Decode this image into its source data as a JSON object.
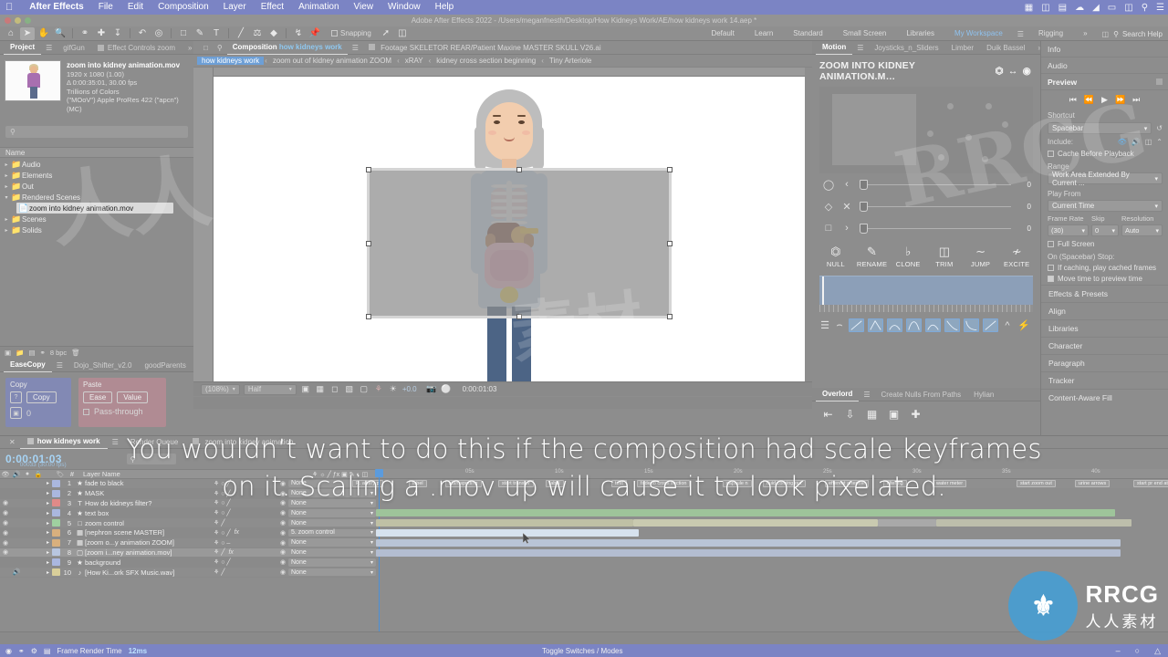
{
  "macmenu": {
    "apple": "apple-logo",
    "items": [
      "After Effects",
      "File",
      "Edit",
      "Composition",
      "Layer",
      "Effect",
      "Animation",
      "View",
      "Window",
      "Help"
    ],
    "right_icons": [
      "▦",
      "⌘",
      "◑",
      "☁",
      "⌗",
      "⊕",
      "▣",
      "ὐD",
      "☰"
    ]
  },
  "title": "Adobe After Effects 2022 - /Users/meganfnesth/Desktop/How Kidneys Work/AE/how kidneys work 14.aep *",
  "toolbar": {
    "tools": [
      "home",
      "selection",
      "hand",
      "zoom",
      "orbit",
      "pan-behind",
      "anchor",
      "rotation",
      "shape",
      "mask",
      "pen",
      "type",
      "brush",
      "clone",
      "eraser",
      "roto",
      "puppet"
    ],
    "snapping_label": "Snapping"
  },
  "workspace": {
    "tabs": [
      "Default",
      "Learn",
      "Standard",
      "Small Screen",
      "Libraries",
      "My Workspace",
      "Rigging"
    ],
    "active": "My Workspace",
    "overflow": "»",
    "search_placeholder": "Search Help"
  },
  "project": {
    "tabs": [
      {
        "label": "Project",
        "active": true
      },
      {
        "label": "gifGun",
        "active": false
      },
      {
        "label": "Effect Controls zoom",
        "active": false
      }
    ],
    "selected_asset": {
      "name": "zoom into kidney animation.mov",
      "dimensions": "1920 x 1080 (1.00)",
      "duration": "Δ 0:00:35:01, 30.00 fps",
      "colors": "Trillions of Colors",
      "codec": "(\"MOoV\") Apple ProRes 422 (\"apcn\") (MC)"
    },
    "search_placeholder": "",
    "column_header": "Name",
    "tree": [
      {
        "label": "Audio",
        "type": "folder",
        "expanded": false,
        "indent": 0
      },
      {
        "label": "Elements",
        "type": "folder",
        "expanded": false,
        "indent": 0
      },
      {
        "label": "Out",
        "type": "folder",
        "expanded": false,
        "indent": 0
      },
      {
        "label": "Rendered Scenes",
        "type": "folder",
        "expanded": true,
        "indent": 0
      },
      {
        "label": "zoom into kidney animation.mov",
        "type": "footage",
        "expanded": false,
        "indent": 1,
        "selected": true
      },
      {
        "label": "Scenes",
        "type": "folder",
        "expanded": false,
        "indent": 0
      },
      {
        "label": "Solids",
        "type": "folder",
        "expanded": false,
        "indent": 0
      }
    ],
    "footer_bpc": "8 bpc"
  },
  "easecopy": {
    "tabs": [
      {
        "label": "EaseCopy",
        "active": true
      },
      {
        "label": "Dojo_Shifter_v2.0",
        "active": false
      },
      {
        "label": "goodParents",
        "active": false
      }
    ],
    "copy_title": "Copy",
    "copy_button": "Copy",
    "copy_value": "0",
    "paste_title": "Paste",
    "paste_ease": "Ease",
    "paste_value": "Value",
    "passthrough": "Pass-through"
  },
  "composition": {
    "tabs": [
      {
        "label_prefix": "Composition",
        "label_name": "how kidneys work",
        "active": true
      },
      {
        "label_prefix": "Footage",
        "label_name": "SKELETOR REAR/Patient Maxine MASTER SKULL V26.ai",
        "active": false
      }
    ],
    "breadcrumb": [
      "how kidneys work",
      "zoom out of kidney animation ZOOM",
      "xRAY",
      "kidney cross section beginning",
      "Tiny Arteriole"
    ],
    "zoom_level": "(108%)",
    "resolution": "Half",
    "exposure": "+0.0",
    "timecode": "0:00:01:03"
  },
  "motion": {
    "tabs": [
      {
        "label": "Motion",
        "active": true
      },
      {
        "label": "Joysticks_n_Sliders",
        "active": false
      },
      {
        "label": "Limber",
        "active": false
      },
      {
        "label": "Duik Bassel",
        "active": false
      }
    ],
    "title": "ZOOM INTO KIDNEY ANIMATION.M…",
    "sliders": [
      {
        "icon_left": "circle-icon",
        "icon_mid": "chevron-left-icon",
        "value": "0"
      },
      {
        "icon_left": "diamond-icon",
        "icon_mid": "close-icon",
        "value": "0"
      },
      {
        "icon_left": "square-icon",
        "icon_mid": "chevron-right-icon",
        "value": "0"
      }
    ],
    "buttons": [
      {
        "label": "NULL",
        "icon": "crop-icon"
      },
      {
        "label": "RENAME",
        "icon": "pencil-icon"
      },
      {
        "label": "CLONE",
        "icon": "columns-icon"
      },
      {
        "label": "TRIM",
        "icon": "trim-icon"
      },
      {
        "label": "JUMP",
        "icon": "jump-icon"
      },
      {
        "label": "EXCITE",
        "icon": "wave-icon"
      }
    ]
  },
  "overlord": {
    "tabs": [
      {
        "label": "Overlord",
        "active": true
      },
      {
        "label": "Create Nulls From Paths",
        "active": false
      },
      {
        "label": "Hylian",
        "active": false
      }
    ]
  },
  "rightstack": {
    "panels": [
      "Info",
      "Audio"
    ],
    "preview": {
      "title": "Preview",
      "shortcut_label": "Shortcut",
      "shortcut_value": "Spacebar",
      "include_label": "Include:",
      "cache_before_playback": "Cache Before Playback",
      "range_label": "Range",
      "range_value": "Work Area Extended By Current ...",
      "play_from_label": "Play From",
      "play_from_value": "Current Time",
      "frame_rate_label": "Frame Rate",
      "frame_rate_value": "(30)",
      "skip_label": "Skip",
      "skip_value": "0",
      "resolution_label": "Resolution",
      "resolution_value": "Auto",
      "full_screen": "Full Screen",
      "on_stop_label": "On (Spacebar) Stop:",
      "if_caching": "If caching, play cached frames",
      "move_time": "Move time to preview time"
    },
    "accordions": [
      "Effects & Presets",
      "Align",
      "Libraries",
      "Character",
      "Paragraph",
      "Tracker",
      "Content-Aware Fill"
    ]
  },
  "timeline": {
    "tabs": [
      {
        "label": "how kidneys work",
        "active": true
      },
      {
        "label": "Render Queue",
        "active": false
      },
      {
        "label": "zoom into kidney animation",
        "active": false
      }
    ],
    "current_time": "0:00:01:03",
    "current_frame": "00033 (30.00 fps)",
    "column_header": "Layer Name",
    "layers": [
      {
        "num": "1",
        "name": "fade to black",
        "icon": "star-icon",
        "color": "#aab7df",
        "parent": "None",
        "visible": false
      },
      {
        "num": "2",
        "name": "MASK",
        "icon": "star-icon",
        "color": "#aab7df",
        "parent": "None",
        "visible": false
      },
      {
        "num": "3",
        "name": "How do kidneys filter?",
        "icon": "text-icon",
        "color": "#e08a88",
        "parent": "None",
        "visible": true
      },
      {
        "num": "4",
        "name": "text box",
        "icon": "star-icon",
        "color": "#aab7df",
        "parent": "None",
        "visible": true
      },
      {
        "num": "5",
        "name": "zoom control",
        "icon": "solid-icon",
        "color": "#9fd0a0",
        "parent": "None",
        "visible": true
      },
      {
        "num": "6",
        "name": "[nephron scene MASTER]",
        "icon": "comp-icon",
        "color": "#d9b07e",
        "parent": "5. zoom control",
        "visible": true
      },
      {
        "num": "7",
        "name": "[zoom o...y animation ZOOM]",
        "icon": "comp-icon",
        "color": "#d9b07e",
        "parent": "None",
        "visible": true
      },
      {
        "num": "8",
        "name": "[zoom i...ney animation.mov]",
        "icon": "footage-icon",
        "color": "#b8c6e0",
        "parent": "None",
        "visible": true,
        "selected": true
      },
      {
        "num": "9",
        "name": "background",
        "icon": "star-icon",
        "color": "#aab7df",
        "parent": "None",
        "visible": false
      },
      {
        "num": "10",
        "name": "[How Ki...ork SFX Music.wav]",
        "icon": "audio-icon",
        "color": "#d9cf9a",
        "parent": "None",
        "visible": false
      }
    ],
    "ruler_ticks": [
      "05s",
      "10s",
      "15s",
      "20s",
      "25s",
      "30s",
      "35s",
      "40s"
    ],
    "markers": [
      "R. artery p",
      "label",
      "start spotting",
      "start transfer",
      "label",
      "text",
      "fade to cross section",
      "capsule n",
      "fluid coming out",
      "efferent arteriole",
      "filtering",
      "water meter",
      "start zoom out",
      "urine arrows",
      "start pr end at blad.ber"
    ],
    "footer_left": "Toggle Switches / Modes"
  },
  "statusbar": {
    "render_label": "Frame Render Time",
    "render_value": "12ms",
    "toggle_label": "Toggle Switches / Modes"
  },
  "subtitle": {
    "line1": "You wouldn’t want to do this if the composition had scale keyframes",
    "line2": "on it. Scaling a .mov up will cause it to look pixelated."
  },
  "watermark": {
    "logo_letters": "RRCG",
    "logo_cn": "人人素材",
    "bg_marks": [
      "RRCG",
      "人人素材"
    ]
  },
  "colors": {
    "accent_blue": "#7b84c4",
    "panel_bg": "#8d8d8d",
    "highlight": "#8fc2ef",
    "timecode_blue": "#a7d4f5"
  }
}
